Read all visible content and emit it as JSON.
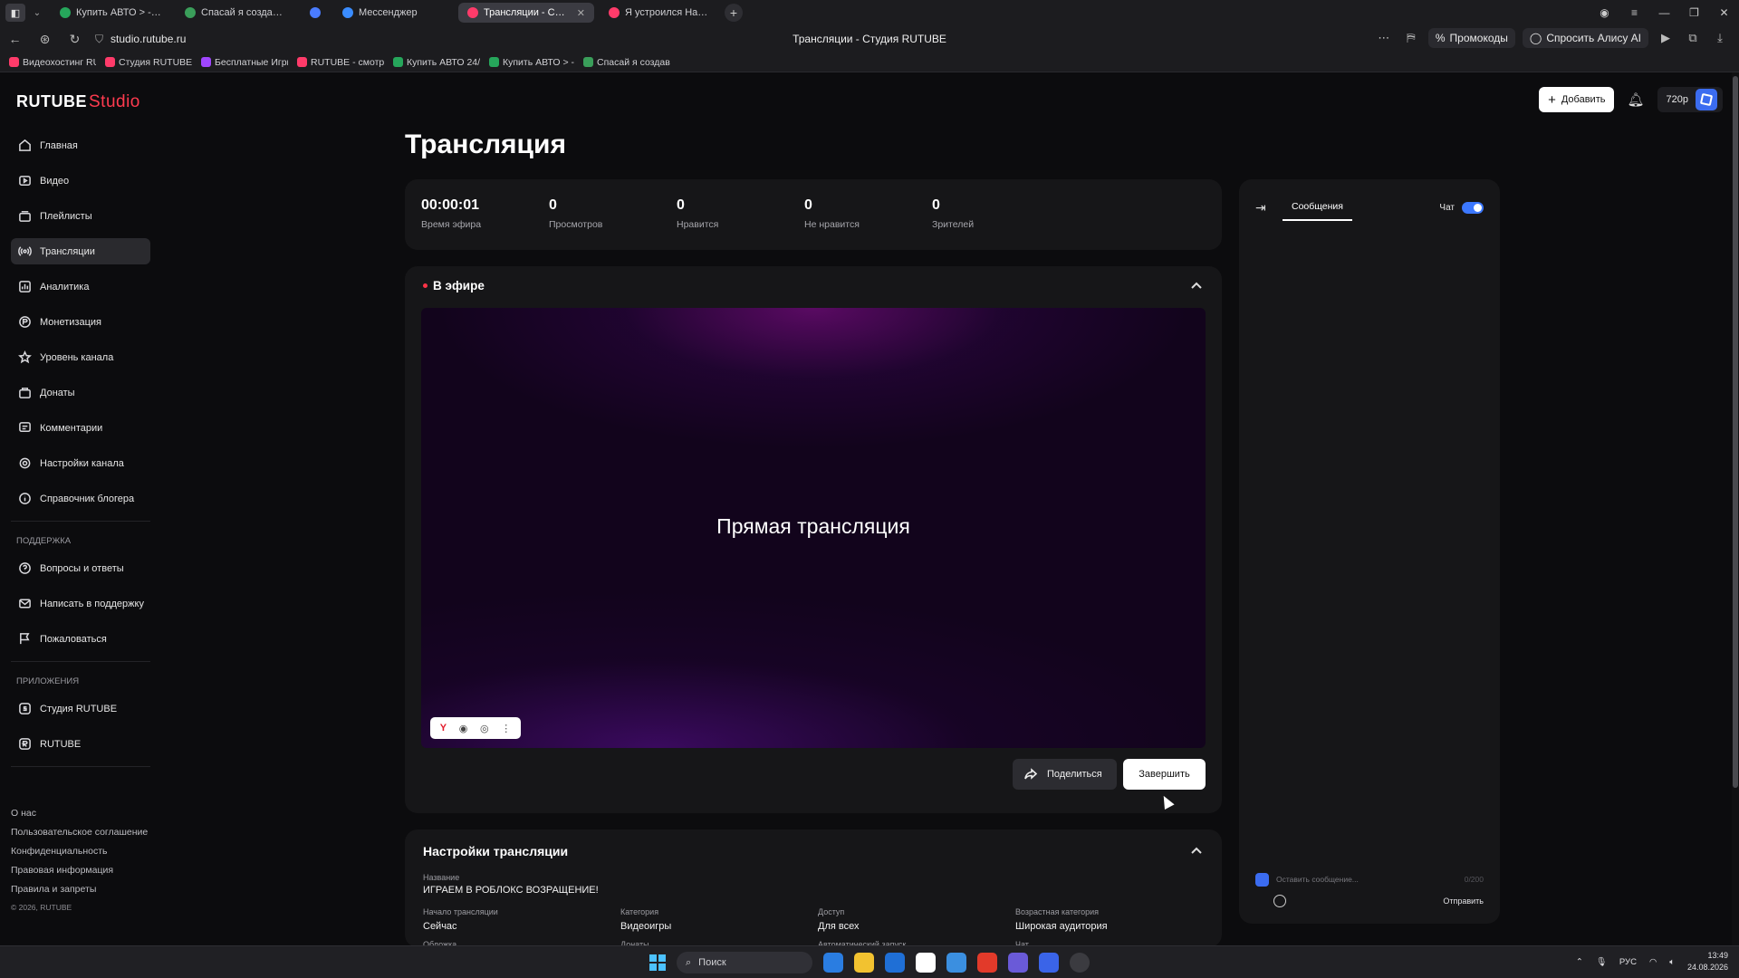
{
  "browser": {
    "tabs": [
      {
        "label": "Купить АВТО > - [ R O B",
        "color": "#26a65b"
      },
      {
        "label": "Спасай я создавал твинк",
        "color": "#3a9e5a"
      },
      {
        "label": "",
        "color": "#4a7cff"
      },
      {
        "label": "Мессенджер",
        "color": "#3a8cff"
      },
      {
        "label": "Трансляции - Студия R",
        "color": "#ff3b6a",
        "active": true
      },
      {
        "label": "Я устроился На САМУЮ",
        "color": "#ff3b6a"
      }
    ],
    "url": "studio.rutube.ru",
    "page_title": "Трансляции - Студия RUTUBE",
    "promo_label": "Промокоды",
    "alice_label": "Спросить Алису AI",
    "bookmarks": [
      {
        "label": "Видеохостинг RU",
        "color": "#ff3b6a"
      },
      {
        "label": "Студия RUTUBE",
        "color": "#ff3b6a"
      },
      {
        "label": "Бесплатные Игры",
        "color": "#a046ff"
      },
      {
        "label": "RUTUBE - смотр",
        "color": "#ff3b6a"
      },
      {
        "label": "Купить АВТО 24/",
        "color": "#26a65b"
      },
      {
        "label": "Купить АВТО > -",
        "color": "#26a65b"
      },
      {
        "label": "Спасай я создав",
        "color": "#3a9e5a"
      }
    ]
  },
  "logo": {
    "brand": "RUTUBE",
    "product": "Studio"
  },
  "sidebar": {
    "items": [
      {
        "label": "Главная",
        "icon": "home-icon"
      },
      {
        "label": "Видео",
        "icon": "video-icon"
      },
      {
        "label": "Плейлисты",
        "icon": "playlist-icon"
      },
      {
        "label": "Трансляции",
        "icon": "broadcast-icon",
        "active": true
      },
      {
        "label": "Аналитика",
        "icon": "analytics-icon"
      },
      {
        "label": "Монетизация",
        "icon": "money-icon"
      },
      {
        "label": "Уровень канала",
        "icon": "star-icon"
      },
      {
        "label": "Донаты",
        "icon": "gift-icon"
      },
      {
        "label": "Комментарии",
        "icon": "comment-icon"
      },
      {
        "label": "Настройки канала",
        "icon": "gear-icon"
      },
      {
        "label": "Справочник блогера",
        "icon": "info-icon"
      }
    ],
    "support_title": "ПОДДЕРЖКА",
    "support": [
      {
        "label": "Вопросы и ответы",
        "icon": "help-icon"
      },
      {
        "label": "Написать в поддержку",
        "icon": "mail-icon"
      },
      {
        "label": "Пожаловаться",
        "icon": "flag-icon"
      }
    ],
    "apps_title": "ПРИЛОЖЕНИЯ",
    "apps": [
      {
        "label": "Студия RUTUBE",
        "icon": "studio-app-icon"
      },
      {
        "label": "RUTUBE",
        "icon": "rutube-app-icon"
      }
    ],
    "footer": [
      "О нас",
      "Пользовательское соглашение",
      "Конфиденциальность",
      "Правовая информация",
      "Правила и запреты"
    ],
    "copyright": "© 2026, RUTUBE"
  },
  "header": {
    "add_label": "Добавить",
    "quality": "720p"
  },
  "page": {
    "title": "Трансляция"
  },
  "stats": [
    {
      "value": "00:00:01",
      "label": "Время эфира"
    },
    {
      "value": "0",
      "label": "Просмотров"
    },
    {
      "value": "0",
      "label": "Нравится"
    },
    {
      "value": "0",
      "label": "Не нравится"
    },
    {
      "value": "0",
      "label": "Зрителей"
    }
  ],
  "live": {
    "title": "В эфире",
    "player_text": "Прямая трансляция",
    "share_label": "Поделиться",
    "end_label": "Завершить"
  },
  "settings": {
    "title": "Настройки трансляции",
    "name_label": "Название",
    "name_value": "ИГРАЕМ В РОБЛОКС ВОЗРАЩЕНИЕ!",
    "fields": [
      {
        "label": "Начало трансляции",
        "value": "Сейчас"
      },
      {
        "label": "Категория",
        "value": "Видеоигры"
      },
      {
        "label": "Доступ",
        "value": "Для всех"
      },
      {
        "label": "Возрастная категория",
        "value": "Широкая аудитория"
      }
    ],
    "next_labels": [
      "Обложка",
      "Донаты",
      "Автоматический запуск",
      "Чат"
    ]
  },
  "chat": {
    "tab_label": "Сообщения",
    "toggle_label": "Чат",
    "toggle_on": true,
    "placeholder": "Оставить сообщение...",
    "counter": "0/200",
    "send_label": "Отправить"
  },
  "taskbar": {
    "search_label": "Поиск",
    "lang": "РУС",
    "time": "13:49",
    "date": "24.08.2026"
  }
}
